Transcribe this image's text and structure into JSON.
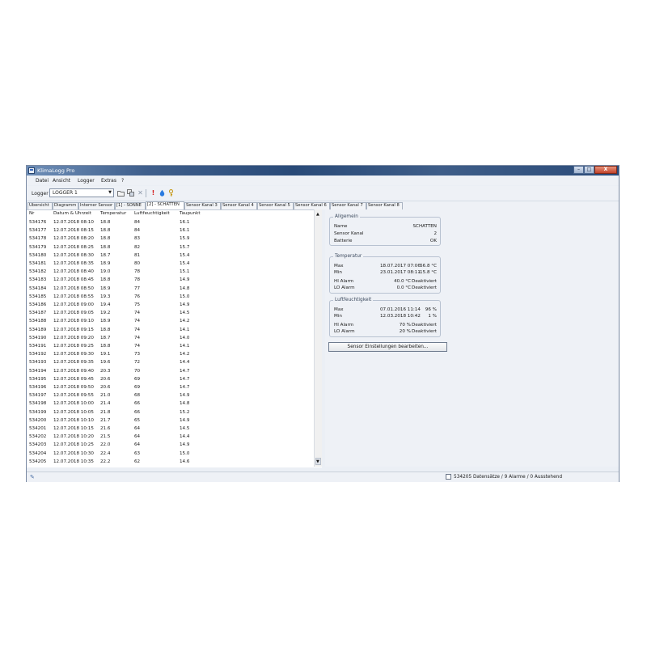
{
  "window": {
    "title": "KlimaLogg Pro",
    "controls": {
      "minimize": "–",
      "maximize": "□",
      "close": "X"
    }
  },
  "menu": [
    "Datei",
    "Ansicht",
    "Logger",
    "Extras",
    "?"
  ],
  "toolbar": {
    "logger_label": "Logger",
    "logger_value": "LOGGER 1",
    "icons": [
      "open-folder-icon",
      "copy-icon",
      "delete-icon",
      "alarm-icon",
      "humidity-drop-icon",
      "key-icon"
    ],
    "icon_colors": {
      "alarm": "#d42020",
      "drop": "#2a7be0",
      "key": "#c79a1b"
    }
  },
  "tabs": [
    "Übersicht",
    "Diagramm",
    "Interner Sensor",
    "[1] - SONNE",
    "[2] - SCHATTEN",
    "Sensor Kanal 3",
    "Sensor Kanal 4",
    "Sensor Kanal 5",
    "Sensor Kanal 6",
    "Sensor Kanal 7",
    "Sensor Kanal 8"
  ],
  "active_tab": "[2] - SCHATTEN",
  "table": {
    "columns": [
      "Nr",
      "Datum & Uhrzeit",
      "Temperatur",
      "Luftfeuchtigkeit",
      "Taupunkt"
    ],
    "rows": [
      [
        "534176",
        "12.07.2018 08:10",
        "18.8",
        "84",
        "16.1"
      ],
      [
        "534177",
        "12.07.2018 08:15",
        "18.8",
        "84",
        "16.1"
      ],
      [
        "534178",
        "12.07.2018 08:20",
        "18.8",
        "83",
        "15.9"
      ],
      [
        "534179",
        "12.07.2018 08:25",
        "18.8",
        "82",
        "15.7"
      ],
      [
        "534180",
        "12.07.2018 08:30",
        "18.7",
        "81",
        "15.4"
      ],
      [
        "534181",
        "12.07.2018 08:35",
        "18.9",
        "80",
        "15.4"
      ],
      [
        "534182",
        "12.07.2018 08:40",
        "19.0",
        "78",
        "15.1"
      ],
      [
        "534183",
        "12.07.2018 08:45",
        "18.8",
        "78",
        "14.9"
      ],
      [
        "534184",
        "12.07.2018 08:50",
        "18.9",
        "77",
        "14.8"
      ],
      [
        "534185",
        "12.07.2018 08:55",
        "19.3",
        "76",
        "15.0"
      ],
      [
        "534186",
        "12.07.2018 09:00",
        "19.4",
        "75",
        "14.9"
      ],
      [
        "534187",
        "12.07.2018 09:05",
        "19.2",
        "74",
        "14.5"
      ],
      [
        "534188",
        "12.07.2018 09:10",
        "18.9",
        "74",
        "14.2"
      ],
      [
        "534189",
        "12.07.2018 09:15",
        "18.8",
        "74",
        "14.1"
      ],
      [
        "534190",
        "12.07.2018 09:20",
        "18.7",
        "74",
        "14.0"
      ],
      [
        "534191",
        "12.07.2018 09:25",
        "18.8",
        "74",
        "14.1"
      ],
      [
        "534192",
        "12.07.2018 09:30",
        "19.1",
        "73",
        "14.2"
      ],
      [
        "534193",
        "12.07.2018 09:35",
        "19.6",
        "72",
        "14.4"
      ],
      [
        "534194",
        "12.07.2018 09:40",
        "20.3",
        "70",
        "14.7"
      ],
      [
        "534195",
        "12.07.2018 09:45",
        "20.6",
        "69",
        "14.7"
      ],
      [
        "534196",
        "12.07.2018 09:50",
        "20.6",
        "69",
        "14.7"
      ],
      [
        "534197",
        "12.07.2018 09:55",
        "21.0",
        "68",
        "14.9"
      ],
      [
        "534198",
        "12.07.2018 10:00",
        "21.4",
        "66",
        "14.8"
      ],
      [
        "534199",
        "12.07.2018 10:05",
        "21.8",
        "66",
        "15.2"
      ],
      [
        "534200",
        "12.07.2018 10:10",
        "21.7",
        "65",
        "14.9"
      ],
      [
        "534201",
        "12.07.2018 10:15",
        "21.6",
        "64",
        "14.5"
      ],
      [
        "534202",
        "12.07.2018 10:20",
        "21.5",
        "64",
        "14.4"
      ],
      [
        "534203",
        "12.07.2018 10:25",
        "22.0",
        "64",
        "14.9"
      ],
      [
        "534204",
        "12.07.2018 10:30",
        "22.4",
        "63",
        "15.0"
      ],
      [
        "534205",
        "12.07.2018 10:35",
        "22.2",
        "62",
        "14.6"
      ]
    ]
  },
  "panel": {
    "allgemein": {
      "title": "Allgemein",
      "name_label": "Name",
      "name_value": "SCHATTEN",
      "kanal_label": "Sensor Kanal",
      "kanal_value": "2",
      "batterie_label": "Batterie",
      "batterie_value": "OK"
    },
    "temperatur": {
      "title": "Temperatur",
      "max_label": "Max",
      "max_date": "18.07.2017 07:06",
      "max_value": "56.8 °C",
      "min_label": "Min",
      "min_date": "23.01.2017 08:11",
      "min_value": "-15.8 °C",
      "hi_label": "HI Alarm",
      "hi_value": "40.0 °C",
      "hi_state": "Deaktiviert",
      "lo_label": "LO Alarm",
      "lo_value": "0.0 °C",
      "lo_state": "Deaktiviert"
    },
    "luftfeuchtigkeit": {
      "title": "Luftfeuchtigkeit",
      "max_label": "Max",
      "max_date": "07.01.2016 11:14",
      "max_value": "96 %",
      "min_label": "Min",
      "min_date": "12.03.2018 10:42",
      "min_value": "1 %",
      "hi_label": "HI Alarm",
      "hi_value": "70 %",
      "hi_state": "Deaktiviert",
      "lo_label": "LO Alarm",
      "lo_value": "20 %",
      "lo_state": "Deaktiviert"
    },
    "edit_button": "Sensor Einstellungen bearbeiten..."
  },
  "status": {
    "text": "534205 Datensätze / 9 Alarme / 0 Ausstehend"
  }
}
